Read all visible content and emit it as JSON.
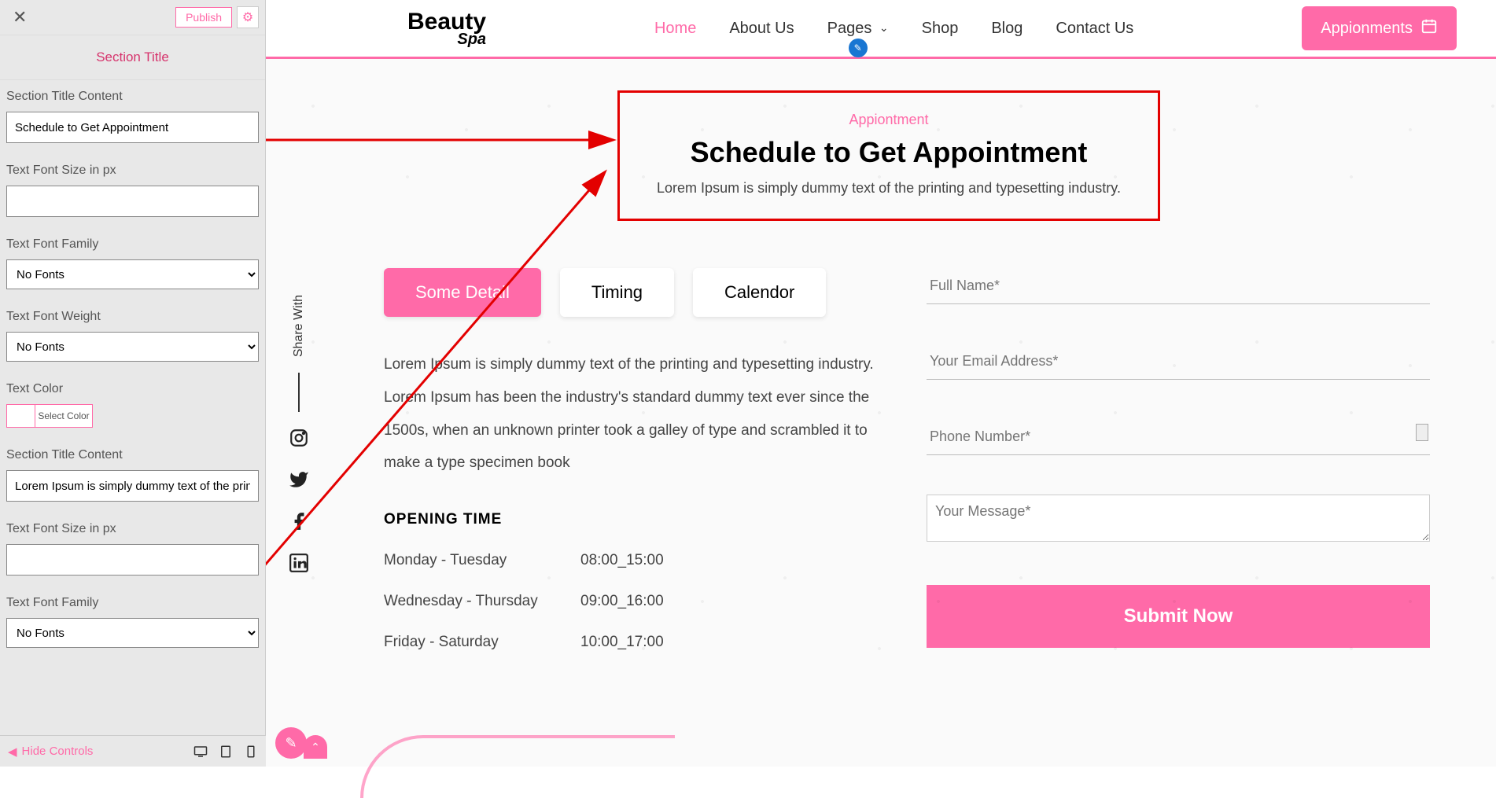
{
  "sidebar": {
    "publish_label": "Publish",
    "section_title_label": "Section Title",
    "controls": {
      "title_content_label": "Section Title Content",
      "title_content_value": "Schedule to Get Appointment",
      "font_size_label": "Text Font Size in px",
      "font_size_value": "",
      "font_family_label": "Text Font Family",
      "font_family_value": "No Fonts",
      "font_weight_label": "Text Font Weight",
      "font_weight_value": "No Fonts",
      "text_color_label": "Text Color",
      "select_color_label": "Select Color",
      "desc_content_label": "Section Title Content",
      "desc_content_value": "Lorem Ipsum is simply dummy text of the printing",
      "font_size_label2": "Text Font Size in px",
      "font_size_value2": "",
      "font_family_label2": "Text Font Family",
      "font_family_value2": "No Fonts"
    },
    "hide_controls_label": "Hide Controls"
  },
  "header": {
    "logo_main": "Beauty",
    "logo_sub": "Spa",
    "nav": {
      "home": "Home",
      "about": "About Us",
      "pages": "Pages",
      "shop": "Shop",
      "blog": "Blog",
      "contact": "Contact Us"
    },
    "appointment_btn": "Appionments"
  },
  "hero": {
    "eyebrow": "Appiontment",
    "title": "Schedule to Get Appointment",
    "subtitle": "Lorem Ipsum is simply dummy text of the printing and typesetting industry."
  },
  "share_label": "Share With",
  "tabs": {
    "detail": "Some Detail",
    "timing": "Timing",
    "calendar": "Calendor"
  },
  "description": "Lorem Ipsum is simply dummy text of the printing and typesetting industry. Lorem Ipsum has been the industry's standard dummy text ever since the 1500s, when an unknown printer took a galley of type and scrambled it to make a type specimen book",
  "opening": {
    "title": "OPENING TIME",
    "rows": [
      {
        "day": "Monday - Tuesday",
        "time": "08:00_15:00"
      },
      {
        "day": "Wednesday - Thursday",
        "time": "09:00_16:00"
      },
      {
        "day": "Friday - Saturday",
        "time": "10:00_17:00"
      }
    ]
  },
  "form": {
    "name_placeholder": "Full Name*",
    "email_placeholder": "Your Email Address*",
    "phone_placeholder": "Phone Number*",
    "message_placeholder": "Your Message*",
    "submit_label": "Submit Now"
  }
}
